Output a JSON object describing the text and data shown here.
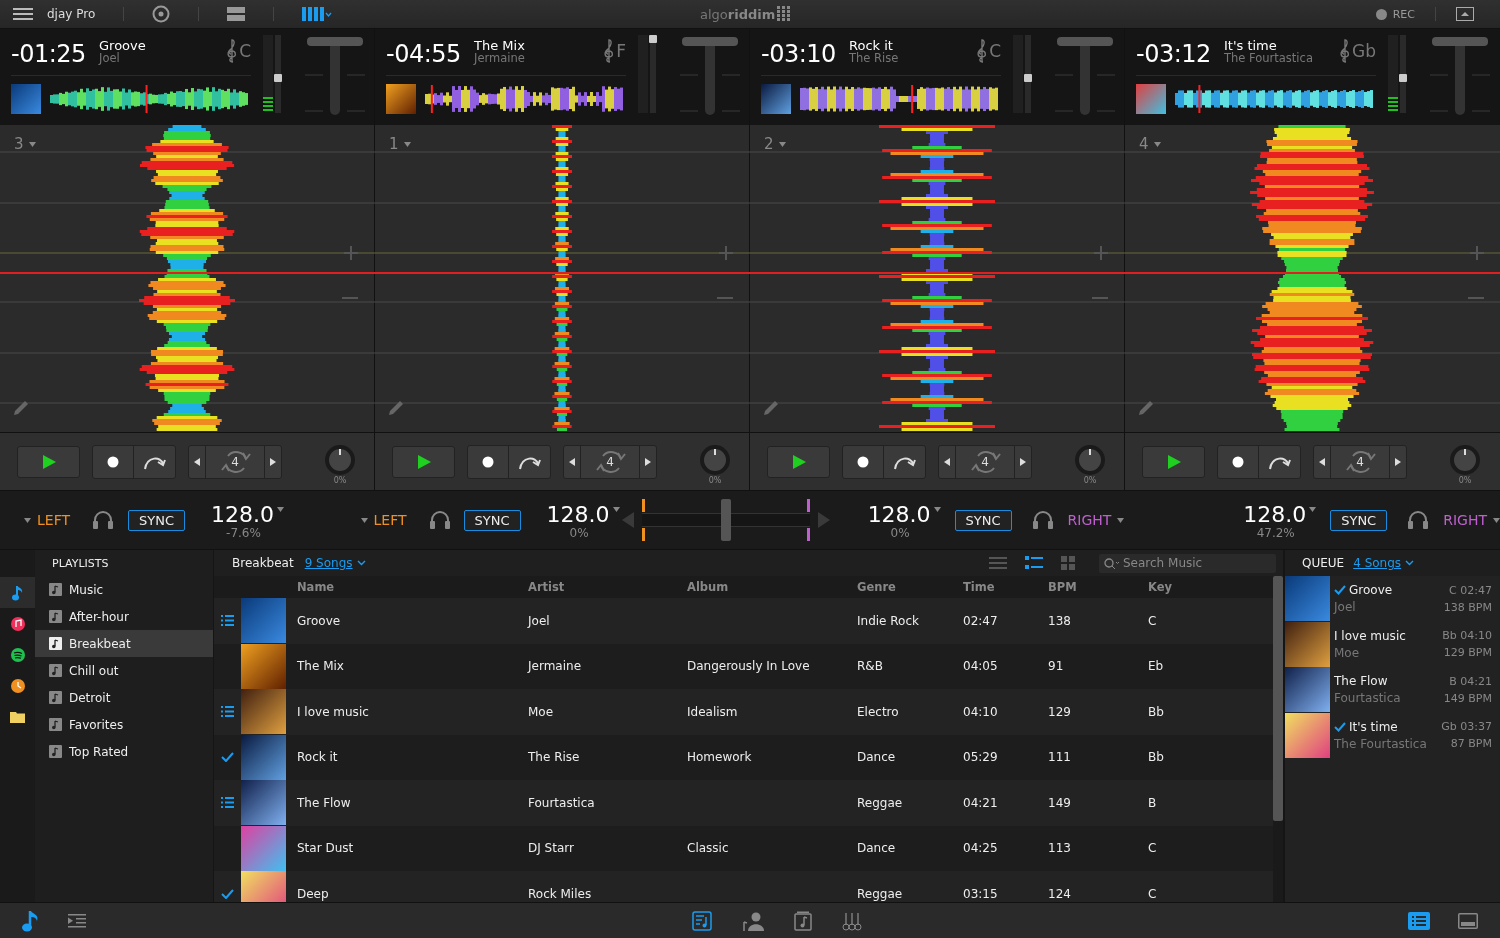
{
  "app": {
    "title": "djay Pro",
    "logo": "algo**riddim**",
    "rec": "REC"
  },
  "layouts": [
    {
      "kind": "vinyl",
      "selected": false
    },
    {
      "kind": "two",
      "selected": false
    },
    {
      "kind": "four",
      "selected": true
    }
  ],
  "decks": [
    {
      "number": "3",
      "time": "-01:25",
      "title": "Groove",
      "artist": "Joel",
      "key": "C",
      "playhead": {
        "level": 0.49
      },
      "meter": {
        "level": 0.2
      },
      "volume": {
        "level": 0.45
      },
      "loop": "4",
      "filter": "0%"
    },
    {
      "number": "1",
      "time": "-04:55",
      "title": "The Mix",
      "artist": "Jermaine",
      "key": "F",
      "playhead": {
        "level": 0.03
      },
      "meter": {
        "level": 0
      },
      "volume": {
        "level": 1
      },
      "loop": "4",
      "filter": "0%"
    },
    {
      "number": "2",
      "time": "-03:10",
      "title": "Rock it",
      "artist": "The Rise",
      "key": "C",
      "playhead": {
        "level": 0.57
      },
      "meter": {
        "level": 0
      },
      "volume": {
        "level": 0.45
      },
      "loop": "4",
      "filter": "0%"
    },
    {
      "number": "4",
      "time": "-03:12",
      "title": "It's time",
      "artist": "The Fourtastica",
      "key": "Gb",
      "playhead": {
        "level": 0.12
      },
      "meter": {
        "level": 0.2
      },
      "volume": {
        "level": 0.45
      },
      "loop": "4",
      "filter": "0%"
    }
  ],
  "mixer": {
    "channels": [
      {
        "kind": "left",
        "output": "LEFT",
        "sync": "SYNC",
        "bpm": "128.0",
        "pitch": "-7.6%"
      },
      {
        "kind": "left",
        "output": "LEFT",
        "sync": "SYNC",
        "bpm": "128.0",
        "pitch": "0%"
      },
      {
        "kind": "right",
        "output": "RIGHT",
        "sync": "SYNC",
        "bpm": "128.0",
        "pitch": "0%"
      },
      {
        "kind": "right",
        "output": "RIGHT",
        "sync": "SYNC",
        "bpm": "128.0",
        "pitch": "47.2%"
      }
    ],
    "crossfader": {
      "level": 0.5
    }
  },
  "sources": [
    {
      "kind": "music",
      "selected": true
    },
    {
      "kind": "itunes",
      "selected": false
    },
    {
      "kind": "spotify",
      "selected": false
    },
    {
      "kind": "history",
      "selected": false
    },
    {
      "kind": "folder",
      "selected": false
    }
  ],
  "playlists": {
    "title": "PLAYLISTS",
    "items": [
      {
        "label": "Music",
        "selected": false
      },
      {
        "label": "After-hour",
        "selected": false
      },
      {
        "label": "Breakbeat",
        "selected": true
      },
      {
        "label": "Chill out",
        "selected": false
      },
      {
        "label": "Detroit",
        "selected": false
      },
      {
        "label": "Favorites",
        "selected": false
      },
      {
        "label": "Top Rated",
        "selected": false
      }
    ]
  },
  "library": {
    "playlist": "Breakbeat",
    "count": "9 Songs",
    "views": [
      {
        "kind": "list",
        "selected": false
      },
      {
        "kind": "detail",
        "selected": true
      },
      {
        "kind": "grid",
        "selected": false
      }
    ],
    "search": {
      "placeholder": "Search Music"
    },
    "columns": [
      "Name",
      "Artist",
      "Album",
      "Genre",
      "Time",
      "BPM",
      "Key"
    ],
    "rows": [
      {
        "queued": true,
        "played": false,
        "name": "Groove",
        "artist": "Joel",
        "album": "",
        "genre": "Indie Rock",
        "time": "02:47",
        "bpm": "138",
        "key": "C"
      },
      {
        "queued": false,
        "played": false,
        "name": "The Mix",
        "artist": "Jermaine",
        "album": "Dangerously In Love",
        "genre": "R&B",
        "time": "04:05",
        "bpm": "91",
        "key": "Eb"
      },
      {
        "queued": true,
        "played": false,
        "name": "I love music",
        "artist": "Moe",
        "album": "Idealism",
        "genre": "Electro",
        "time": "04:10",
        "bpm": "129",
        "key": "Bb"
      },
      {
        "queued": false,
        "played": true,
        "name": "Rock it",
        "artist": "The Rise",
        "album": "Homework",
        "genre": "Dance",
        "time": "05:29",
        "bpm": "111",
        "key": "Bb"
      },
      {
        "queued": true,
        "played": false,
        "name": "The Flow",
        "artist": "Fourtastica",
        "album": "",
        "genre": "Reggae",
        "time": "04:21",
        "bpm": "149",
        "key": "B"
      },
      {
        "queued": false,
        "played": false,
        "name": "Star Dust",
        "artist": "DJ Starr",
        "album": "Classic",
        "genre": "Dance",
        "time": "04:25",
        "bpm": "113",
        "key": "C"
      },
      {
        "queued": false,
        "played": true,
        "name": "Deep",
        "artist": "Rock Miles",
        "album": "",
        "genre": "Reggae",
        "time": "03:15",
        "bpm": "124",
        "key": "C"
      }
    ]
  },
  "queue": {
    "title": "QUEUE",
    "count": "4 Songs",
    "items": [
      {
        "played": true,
        "title": "Groove",
        "artist": "Joel",
        "key_time": "C 02:47",
        "bpm": "138 BPM"
      },
      {
        "played": false,
        "title": "I love music",
        "artist": "Moe",
        "key_time": "Bb 04:10",
        "bpm": "129 BPM"
      },
      {
        "played": false,
        "title": "The Flow",
        "artist": "Fourtastica",
        "key_time": "B 04:21",
        "bpm": "149 BPM"
      },
      {
        "played": true,
        "title": "It's time",
        "artist": "The Fourtastica",
        "key_time": "Gb 03:37",
        "bpm": "87 BPM"
      }
    ]
  },
  "bottom": {
    "left": [
      {
        "kind": "music",
        "selected": true
      },
      {
        "kind": "indent",
        "selected": false
      }
    ],
    "center": [
      {
        "kind": "library",
        "selected": true
      },
      {
        "kind": "artist",
        "selected": false
      },
      {
        "kind": "media",
        "selected": false
      },
      {
        "kind": "samples",
        "selected": false
      }
    ],
    "right": [
      {
        "kind": "list",
        "selected": true
      },
      {
        "kind": "screen",
        "selected": false
      }
    ]
  }
}
